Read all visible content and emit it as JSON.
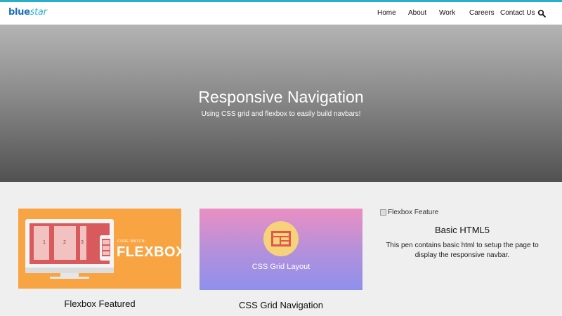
{
  "brand": {
    "logo_part1": "blue",
    "logo_part2": "star"
  },
  "nav": {
    "items": [
      "Home",
      "About",
      "Work",
      "Careers",
      "Contact Us"
    ],
    "search_icon": "search-icon"
  },
  "hero": {
    "title": "Responsive Navigation",
    "subtitle": "Using CSS grid and flexbox to easily build navbars!"
  },
  "cards": [
    {
      "title": "Flexbox Featured",
      "image_badge": "CODE WATCH:",
      "image_text": "FLEXBOX",
      "screen_labels": [
        "1",
        "2",
        "3"
      ]
    },
    {
      "title": "CSS Grid Navigation",
      "image_text": "CSS Grid Layout"
    },
    {
      "image_alt": "Flexbox Feature",
      "title": "Basic HTML5",
      "description": "This pen contains basic html to setup the page to display the responsive navbar."
    }
  ],
  "colors": {
    "accent": "#27b0c9",
    "flexbox_bg": "#f9a443",
    "grid_icon": "#f6d27a"
  }
}
